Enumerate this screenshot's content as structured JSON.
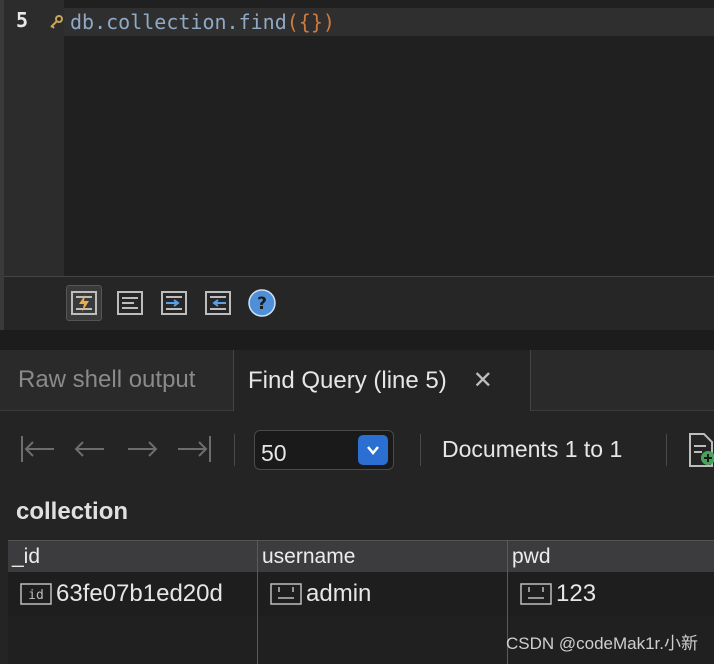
{
  "editor": {
    "line_number": "5",
    "code_object": "db.collection.find",
    "code_args": "({})",
    "previous_line_stub": ";;;"
  },
  "toolbar": {
    "icons": [
      "execute-icon",
      "execute-statement-icon",
      "step-into-icon",
      "step-out-icon",
      "help-icon"
    ]
  },
  "tabs": {
    "raw_output": "Raw shell output",
    "find_query": "Find Query (line 5)",
    "close": "✕"
  },
  "pager": {
    "page_size": "50",
    "documents_label": "Documents 1 to 1"
  },
  "collection_label": "collection",
  "table": {
    "columns": [
      "_id",
      "username",
      "pwd"
    ],
    "rows": [
      {
        "_id": "63fe07b1ed20d",
        "username": "admin",
        "pwd": "123"
      }
    ]
  },
  "watermark": "CSDN @codeMak1r.小新",
  "colors": {
    "accent": "#2a6fd1",
    "code_object": "#8fa9c6",
    "code_brace": "#d07b3c",
    "help_icon": "#4f8fd8"
  }
}
